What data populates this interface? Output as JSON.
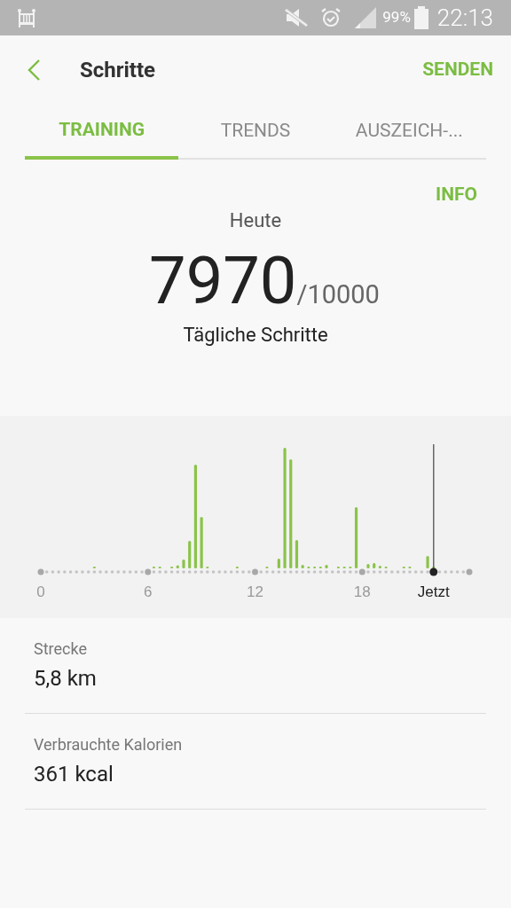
{
  "status_bar": {
    "battery_text": "99%",
    "time": "22:13"
  },
  "header": {
    "title": "Schritte",
    "action": "SENDEN"
  },
  "tabs": [
    {
      "label": "TRAINING",
      "selected": true
    },
    {
      "label": "TRENDS",
      "selected": false
    },
    {
      "label": "AUSZEICH-...",
      "selected": false
    }
  ],
  "info_link": "INFO",
  "summary": {
    "day": "Heute",
    "steps": "7970",
    "goal": "/10000",
    "caption": "Tägliche Schritte"
  },
  "chart": {
    "x_labels": [
      {
        "label": "0",
        "kind": "hour"
      },
      {
        "label": "6",
        "kind": "hour"
      },
      {
        "label": "12",
        "kind": "hour"
      },
      {
        "label": "18",
        "kind": "hour"
      },
      {
        "label": "Jetzt",
        "kind": "now"
      }
    ]
  },
  "stats": [
    {
      "label": "Strecke",
      "value": "5,8 km"
    },
    {
      "label": "Verbrauchte Kalorien",
      "value": "361 kcal"
    }
  ]
}
